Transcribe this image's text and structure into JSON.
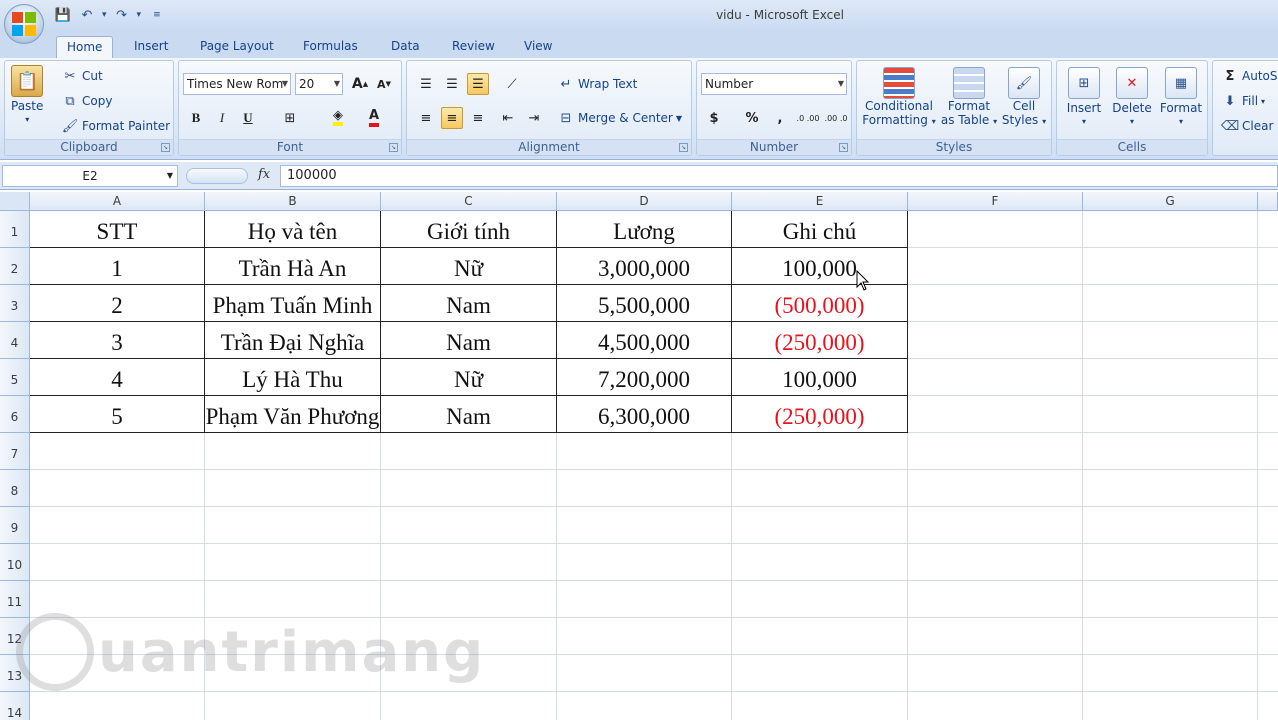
{
  "window": {
    "title": "vidu - Microsoft Excel"
  },
  "tabs": [
    "Home",
    "Insert",
    "Page Layout",
    "Formulas",
    "Data",
    "Review",
    "View"
  ],
  "ribbon": {
    "clipboard": {
      "label": "Clipboard",
      "paste": "Paste",
      "cut": "Cut",
      "copy": "Copy",
      "format_painter": "Format Painter"
    },
    "font": {
      "label": "Font",
      "font_name": "Times New Rom",
      "font_size": "20",
      "bold": "B",
      "italic": "I",
      "underline": "U",
      "grow": "A",
      "shrink": "A",
      "font_color": "A"
    },
    "alignment": {
      "label": "Alignment",
      "wrap_text": "Wrap Text",
      "merge_center": "Merge & Center"
    },
    "number": {
      "label": "Number",
      "format": "Number",
      "currency": "$",
      "percent": "%",
      "comma": ",",
      "inc_decimal": ".0 .00",
      "dec_decimal": ".00 .0"
    },
    "styles": {
      "label": "Styles",
      "conditional_1": "Conditional",
      "conditional_2": "Formatting",
      "format_table_1": "Format",
      "format_table_2": "as Table",
      "cell_styles_1": "Cell",
      "cell_styles_2": "Styles"
    },
    "cells": {
      "label": "Cells",
      "insert": "Insert",
      "delete": "Delete",
      "format": "Format"
    },
    "editing": {
      "autosum": "AutoS",
      "fill": "Fill",
      "clear": "Clear"
    }
  },
  "formula_bar": {
    "name_box": "E2",
    "fx": "fx",
    "value": "100000"
  },
  "columns": [
    "A",
    "B",
    "C",
    "D",
    "E",
    "F",
    "G"
  ],
  "rows": [
    "1",
    "2",
    "3",
    "4",
    "5",
    "6",
    "7",
    "8",
    "9",
    "10",
    "11",
    "12",
    "13",
    "14"
  ],
  "table": {
    "header": [
      "STT",
      "Họ và tên",
      "Giới tính",
      "Lương",
      "Ghi chú"
    ],
    "rows": [
      [
        "1",
        "Trần Hà An",
        "Nữ",
        "3,000,000",
        "100,000"
      ],
      [
        "2",
        "Phạm Tuấn Minh",
        "Nam",
        "5,500,000",
        "(500,000)"
      ],
      [
        "3",
        "Trần Đại Nghĩa",
        "Nam",
        "4,500,000",
        "(250,000)"
      ],
      [
        "4",
        "Lý Hà Thu",
        "Nữ",
        "7,200,000",
        "100,000"
      ],
      [
        "5",
        "Phạm Văn Phương",
        "Nam",
        "6,300,000",
        "(250,000)"
      ]
    ]
  },
  "colors": {
    "negative": "#e8121e",
    "ribbon_text": "#15428b"
  },
  "watermark": {
    "text": "uantrimang"
  }
}
